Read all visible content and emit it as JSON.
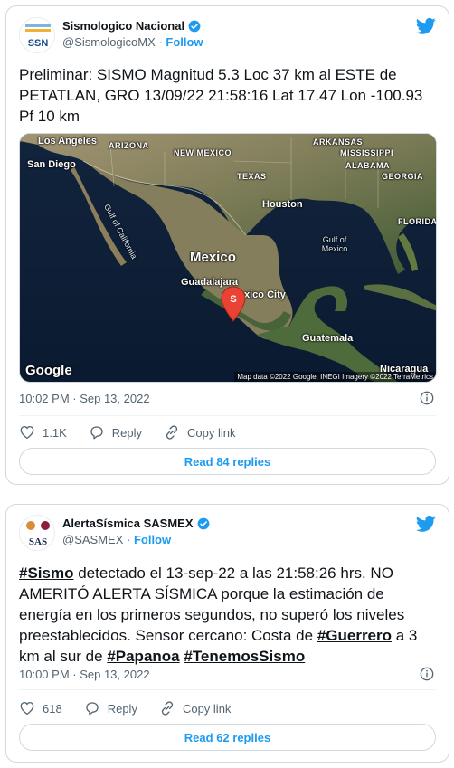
{
  "tweet1": {
    "display_name": "Sismologico Nacional",
    "handle": "@SismologicoMX",
    "separator": "·",
    "follow_label": "Follow",
    "avatar_text": "SSN",
    "text": "Preliminar: SISMO Magnitud 5.3 Loc  37 km al ESTE de PETATLAN, GRO 13/09/22 21:58:16 Lat 17.47 Lon -100.93 Pf 10 km",
    "map": {
      "labels": {
        "los_angeles": "Los Angeles",
        "arizona": "ARIZONA",
        "new_mexico": "NEW MEXICO",
        "arkansas": "ARKANSAS",
        "mississippi": "MISSISSIPPI",
        "san_diego": "San Diego",
        "alabama": "ALABAMA",
        "georgia": "GEORGIA",
        "texas": "TEXAS",
        "houston": "Houston",
        "gulf_of_california": "Gulf of California",
        "florida": "FLORIDA",
        "gulf_of_mexico": "Gulf of Mexico",
        "mexico": "Mexico",
        "guadalajara": "Guadalajara",
        "mexico_city": "xico City",
        "guatemala": "Guatemala",
        "nicaragua": "Nicaragua"
      },
      "pin_letter": "S",
      "google": "Google",
      "attribution": "Map data ©2022 Google, INEGI Imagery ©2022 TerraMetrics"
    },
    "timestamp": "10:02 PM · Sep 13, 2022",
    "likes": "1.1K",
    "reply_label": "Reply",
    "copy_link_label": "Copy link",
    "read_replies": "Read 84 replies"
  },
  "tweet2": {
    "display_name": "AlertaSísmica SASMEX",
    "handle": "@SASMEX",
    "separator": "·",
    "follow_label": "Follow",
    "avatar_text": "SAS",
    "text_parts": {
      "tag_sismo": "#Sismo",
      "t1": " detectado el 13-sep-22 a las 21:58:26 hrs. NO AMERITÓ ALERTA SÍSMICA porque la estimación de energía en los primeros segundos, no superó los niveles preestablecidos. Sensor cercano: Costa de ",
      "tag_guerrero": "#Guerrero",
      "t2": " a 3 km al sur de ",
      "tag_papanoa": "#Papanoa",
      "t3": " ",
      "tag_tenemos": "#TenemosSismo"
    },
    "timestamp": "10:00 PM · Sep 13, 2022",
    "likes": "618",
    "reply_label": "Reply",
    "copy_link_label": "Copy link",
    "read_replies": "Read 62 replies"
  },
  "colors": {
    "accent": "#1d9bf0",
    "text": "#0f1419",
    "muted": "#536471",
    "pin": "#ea4335"
  }
}
